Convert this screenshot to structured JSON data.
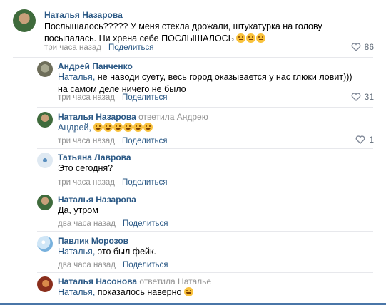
{
  "comments": [
    {
      "name": "Наталья Назарова",
      "answered": "",
      "text": "Послышалось????? У меня стекла дрожали, штукатурка на голову посыпалась. Ни хрена себе ПОСЛЫШАЛОСЬ",
      "time": "три часа назад",
      "share": "Поделиться",
      "likes": "86",
      "avatar_colors": [
        "#3f6b3c",
        "#c9a07a"
      ]
    },
    {
      "name": "Андрей Панченко",
      "mention": "Наталья,",
      "text": " не наводи суету, весь город оказывается у нас глюки ловит))) на самом деле ничего не было",
      "time": "три часа назад",
      "share": "Поделиться",
      "likes": "31",
      "avatar_colors": [
        "#6e6e5a",
        "#a8a890"
      ]
    },
    {
      "name": "Наталья Назарова",
      "answered": "ответила Андрею",
      "mention": "Андрей,",
      "time": "три часа назад",
      "share": "Поделиться",
      "likes": "1",
      "avatar_colors": [
        "#3f6b3c",
        "#c9a07a"
      ]
    },
    {
      "name": "Татьяна Лаврова",
      "text": "Это сегодня?",
      "time": "три часа назад",
      "share": "Поделиться",
      "avatar_colors": [
        "#dfe9f2",
        "#5a8fbf"
      ]
    },
    {
      "name": "Наталья Назарова",
      "text": "Да, утром",
      "time": "два часа назад",
      "share": "Поделиться",
      "avatar_colors": [
        "#3f6b3c",
        "#c9a07a"
      ]
    },
    {
      "name": "Павлик Морозов",
      "mention": "Наталья,",
      "text": " это был фейк.",
      "time": "два часа назад",
      "share": "Поделиться",
      "avatar_colors": [
        "#cfe6f7",
        "#78b1dd"
      ]
    },
    {
      "name": "Наталья Насонова",
      "answered": "ответила Наталье",
      "mention": "Наталья,",
      "text": " показалось наверно",
      "avatar_colors": [
        "#8a2e1c",
        "#d98a4a"
      ]
    }
  ],
  "colors": {
    "link": "#2a5885",
    "meta": "#939393",
    "bar": "#4a76a8"
  },
  "icons": {
    "like": "heart-icon"
  }
}
